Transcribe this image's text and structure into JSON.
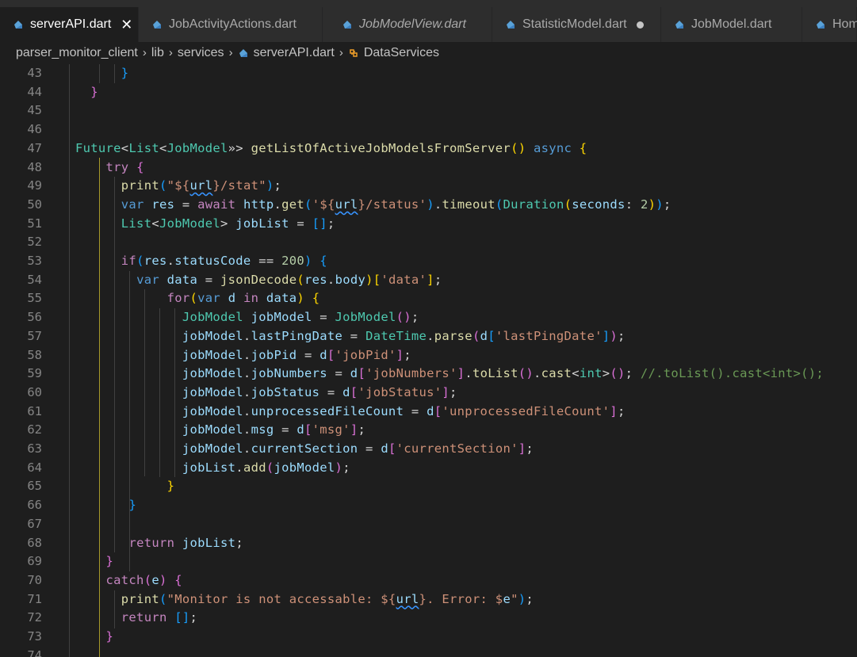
{
  "tabs": [
    {
      "label": "serverAPI.dart",
      "active": true,
      "italic": false,
      "close": "✕"
    },
    {
      "label": "JobActivityActions.dart",
      "active": false,
      "italic": false
    },
    {
      "label": "JobModelView.dart",
      "active": false,
      "italic": true
    },
    {
      "label": "StatisticModel.dart",
      "active": false,
      "italic": false,
      "modified": true
    },
    {
      "label": "JobModel.dart",
      "active": false,
      "italic": false
    },
    {
      "label": "Hom",
      "active": false,
      "italic": false
    }
  ],
  "breadcrumb": {
    "items": [
      "parser_monitor_client",
      "lib",
      "services",
      "serverAPI.dart",
      "DataServices"
    ],
    "separator": "›"
  },
  "colors": {
    "background": "#1e1e1e",
    "tab_inactive": "#2d2d2d",
    "keyword": "#569cd6",
    "control": "#c586c0",
    "type": "#4ec9b0",
    "function": "#dcdcaa",
    "string": "#ce9178",
    "number": "#b5cea8",
    "variable": "#9cdcfe",
    "comment": "#6a9955",
    "dart_icon": "#5aa2d8"
  },
  "lines": [
    {
      "n": "43",
      "indent": "      ",
      "tokens": [
        [
          "b3",
          "}"
        ]
      ]
    },
    {
      "n": "44",
      "indent": "  ",
      "tokens": [
        [
          "b2",
          "}"
        ]
      ]
    },
    {
      "n": "45",
      "indent": "",
      "tokens": []
    },
    {
      "n": "46",
      "indent": "",
      "tokens": []
    },
    {
      "n": "47",
      "indent": "",
      "tokens": [
        [
          "typ",
          "Future"
        ],
        [
          "pl",
          "<"
        ],
        [
          "typ",
          "List"
        ],
        [
          "pl",
          "<"
        ],
        [
          "typ",
          "JobModel"
        ],
        [
          "pl",
          "»> "
        ],
        [
          "fn",
          "getListOfActiveJobModelsFromServer"
        ],
        [
          "b1",
          "()"
        ],
        [
          "pl",
          " "
        ],
        [
          "kw",
          "async"
        ],
        [
          "pl",
          " "
        ],
        [
          "b1",
          "{"
        ]
      ]
    },
    {
      "n": "48",
      "indent": "    ",
      "tokens": [
        [
          "ctl",
          "try"
        ],
        [
          "pl",
          " "
        ],
        [
          "b2",
          "{"
        ]
      ]
    },
    {
      "n": "49",
      "indent": "      ",
      "tokens": [
        [
          "fn",
          "print"
        ],
        [
          "b3",
          "("
        ],
        [
          "str",
          "\"${"
        ],
        [
          "var squig",
          "url"
        ],
        [
          "str",
          "}/stat\""
        ],
        [
          "b3",
          ")"
        ],
        [
          "pl",
          ";"
        ]
      ]
    },
    {
      "n": "50",
      "indent": "      ",
      "tokens": [
        [
          "kw",
          "var"
        ],
        [
          "pl",
          " "
        ],
        [
          "var",
          "res"
        ],
        [
          "pl",
          " = "
        ],
        [
          "ctl",
          "await"
        ],
        [
          "pl",
          " "
        ],
        [
          "var",
          "http"
        ],
        [
          "pl",
          "."
        ],
        [
          "fn",
          "get"
        ],
        [
          "b3",
          "("
        ],
        [
          "str",
          "'${"
        ],
        [
          "var squig",
          "url"
        ],
        [
          "str",
          "}/status'"
        ],
        [
          "b3",
          ")"
        ],
        [
          "pl",
          "."
        ],
        [
          "fn",
          "timeout"
        ],
        [
          "b3",
          "("
        ],
        [
          "typ",
          "Duration"
        ],
        [
          "b1",
          "("
        ],
        [
          "var",
          "seconds"
        ],
        [
          "pl",
          ": "
        ],
        [
          "num",
          "2"
        ],
        [
          "b1",
          ")"
        ],
        [
          "b3",
          ")"
        ],
        [
          "pl",
          ";"
        ]
      ]
    },
    {
      "n": "51",
      "indent": "      ",
      "tokens": [
        [
          "typ",
          "List"
        ],
        [
          "pl",
          "<"
        ],
        [
          "typ",
          "JobModel"
        ],
        [
          "pl",
          "> "
        ],
        [
          "var",
          "jobList"
        ],
        [
          "pl",
          " = "
        ],
        [
          "b3",
          "[]"
        ],
        [
          "pl",
          ";"
        ]
      ]
    },
    {
      "n": "52",
      "indent": "",
      "tokens": []
    },
    {
      "n": "53",
      "indent": "      ",
      "tokens": [
        [
          "ctl",
          "if"
        ],
        [
          "b3",
          "("
        ],
        [
          "var",
          "res"
        ],
        [
          "pl",
          "."
        ],
        [
          "var",
          "statusCode"
        ],
        [
          "pl",
          " == "
        ],
        [
          "num",
          "200"
        ],
        [
          "b3",
          ")"
        ],
        [
          "pl",
          " "
        ],
        [
          "b3",
          "{"
        ]
      ]
    },
    {
      "n": "54",
      "indent": "        ",
      "tokens": [
        [
          "kw",
          "var"
        ],
        [
          "pl",
          " "
        ],
        [
          "var",
          "data"
        ],
        [
          "pl",
          " = "
        ],
        [
          "fn",
          "jsonDecode"
        ],
        [
          "b1",
          "("
        ],
        [
          "var",
          "res"
        ],
        [
          "pl",
          "."
        ],
        [
          "var",
          "body"
        ],
        [
          "b1",
          ")"
        ],
        [
          "b1",
          "["
        ],
        [
          "str",
          "'data'"
        ],
        [
          "b1",
          "]"
        ],
        [
          "pl",
          ";"
        ]
      ]
    },
    {
      "n": "55",
      "indent": "            ",
      "tokens": [
        [
          "ctl",
          "for"
        ],
        [
          "b1",
          "("
        ],
        [
          "kw",
          "var"
        ],
        [
          "pl",
          " "
        ],
        [
          "var",
          "d"
        ],
        [
          "pl",
          " "
        ],
        [
          "ctl",
          "in"
        ],
        [
          "pl",
          " "
        ],
        [
          "var",
          "data"
        ],
        [
          "b1",
          ")"
        ],
        [
          "pl",
          " "
        ],
        [
          "b1",
          "{"
        ]
      ]
    },
    {
      "n": "56",
      "indent": "              ",
      "tokens": [
        [
          "typ",
          "JobModel"
        ],
        [
          "pl",
          " "
        ],
        [
          "var",
          "jobModel"
        ],
        [
          "pl",
          " = "
        ],
        [
          "typ",
          "JobModel"
        ],
        [
          "b2",
          "()"
        ],
        [
          "pl",
          ";"
        ]
      ]
    },
    {
      "n": "57",
      "indent": "              ",
      "tokens": [
        [
          "var",
          "jobModel"
        ],
        [
          "pl",
          "."
        ],
        [
          "var",
          "lastPingDate"
        ],
        [
          "pl",
          " = "
        ],
        [
          "typ",
          "DateTime"
        ],
        [
          "pl",
          "."
        ],
        [
          "fn",
          "parse"
        ],
        [
          "b2",
          "("
        ],
        [
          "var",
          "d"
        ],
        [
          "b3",
          "["
        ],
        [
          "str",
          "'lastPingDate'"
        ],
        [
          "b3",
          "]"
        ],
        [
          "b2",
          ")"
        ],
        [
          "pl",
          ";"
        ]
      ]
    },
    {
      "n": "58",
      "indent": "              ",
      "tokens": [
        [
          "var",
          "jobModel"
        ],
        [
          "pl",
          "."
        ],
        [
          "var",
          "jobPid"
        ],
        [
          "pl",
          " = "
        ],
        [
          "var",
          "d"
        ],
        [
          "b2",
          "["
        ],
        [
          "str",
          "'jobPid'"
        ],
        [
          "b2",
          "]"
        ],
        [
          "pl",
          ";"
        ]
      ]
    },
    {
      "n": "59",
      "indent": "              ",
      "tokens": [
        [
          "var",
          "jobModel"
        ],
        [
          "pl",
          "."
        ],
        [
          "var",
          "jobNumbers"
        ],
        [
          "pl",
          " = "
        ],
        [
          "var",
          "d"
        ],
        [
          "b2",
          "["
        ],
        [
          "str",
          "'jobNumbers'"
        ],
        [
          "b2",
          "]"
        ],
        [
          "pl",
          "."
        ],
        [
          "fn",
          "toList"
        ],
        [
          "b2",
          "()"
        ],
        [
          "pl",
          "."
        ],
        [
          "fn",
          "cast"
        ],
        [
          "pl",
          "<"
        ],
        [
          "typ",
          "int"
        ],
        [
          "pl",
          ">"
        ],
        [
          "b2",
          "()"
        ],
        [
          "pl",
          "; "
        ],
        [
          "cmt",
          "//.toList().cast<int>();"
        ]
      ]
    },
    {
      "n": "60",
      "indent": "              ",
      "tokens": [
        [
          "var",
          "jobModel"
        ],
        [
          "pl",
          "."
        ],
        [
          "var",
          "jobStatus"
        ],
        [
          "pl",
          " = "
        ],
        [
          "var",
          "d"
        ],
        [
          "b2",
          "["
        ],
        [
          "str",
          "'jobStatus'"
        ],
        [
          "b2",
          "]"
        ],
        [
          "pl",
          ";"
        ]
      ]
    },
    {
      "n": "61",
      "indent": "              ",
      "tokens": [
        [
          "var",
          "jobModel"
        ],
        [
          "pl",
          "."
        ],
        [
          "var",
          "unprocessedFileCount"
        ],
        [
          "pl",
          " = "
        ],
        [
          "var",
          "d"
        ],
        [
          "b2",
          "["
        ],
        [
          "str",
          "'unprocessedFileCount'"
        ],
        [
          "b2",
          "]"
        ],
        [
          "pl",
          ";"
        ]
      ]
    },
    {
      "n": "62",
      "indent": "              ",
      "tokens": [
        [
          "var",
          "jobModel"
        ],
        [
          "pl",
          "."
        ],
        [
          "var",
          "msg"
        ],
        [
          "pl",
          " = "
        ],
        [
          "var",
          "d"
        ],
        [
          "b2",
          "["
        ],
        [
          "str",
          "'msg'"
        ],
        [
          "b2",
          "]"
        ],
        [
          "pl",
          ";"
        ]
      ]
    },
    {
      "n": "63",
      "indent": "              ",
      "tokens": [
        [
          "var",
          "jobModel"
        ],
        [
          "pl",
          "."
        ],
        [
          "var",
          "currentSection"
        ],
        [
          "pl",
          " = "
        ],
        [
          "var",
          "d"
        ],
        [
          "b2",
          "["
        ],
        [
          "str",
          "'currentSection'"
        ],
        [
          "b2",
          "]"
        ],
        [
          "pl",
          ";"
        ]
      ]
    },
    {
      "n": "64",
      "indent": "              ",
      "tokens": [
        [
          "var",
          "jobList"
        ],
        [
          "pl",
          "."
        ],
        [
          "fn",
          "add"
        ],
        [
          "b2",
          "("
        ],
        [
          "var",
          "jobModel"
        ],
        [
          "b2",
          ")"
        ],
        [
          "pl",
          ";"
        ]
      ]
    },
    {
      "n": "65",
      "indent": "            ",
      "tokens": [
        [
          "b1",
          "}"
        ]
      ]
    },
    {
      "n": "66",
      "indent": "       ",
      "tokens": [
        [
          "b3",
          "}"
        ]
      ]
    },
    {
      "n": "67",
      "indent": "",
      "tokens": []
    },
    {
      "n": "68",
      "indent": "       ",
      "tokens": [
        [
          "ctl",
          "return"
        ],
        [
          "pl",
          " "
        ],
        [
          "var",
          "jobList"
        ],
        [
          "pl",
          ";"
        ]
      ]
    },
    {
      "n": "69",
      "indent": "    ",
      "tokens": [
        [
          "b2",
          "}"
        ]
      ]
    },
    {
      "n": "70",
      "indent": "    ",
      "tokens": [
        [
          "ctl",
          "catch"
        ],
        [
          "b2",
          "("
        ],
        [
          "var",
          "e"
        ],
        [
          "b2",
          ")"
        ],
        [
          "pl",
          " "
        ],
        [
          "b2",
          "{"
        ]
      ]
    },
    {
      "n": "71",
      "indent": "      ",
      "tokens": [
        [
          "fn",
          "print"
        ],
        [
          "b3",
          "("
        ],
        [
          "str",
          "\"Monitor is not accessable: ${"
        ],
        [
          "var squig",
          "url"
        ],
        [
          "str",
          "}. Error: $"
        ],
        [
          "var",
          "e"
        ],
        [
          "str",
          "\""
        ],
        [
          "b3",
          ")"
        ],
        [
          "pl",
          ";"
        ]
      ]
    },
    {
      "n": "72",
      "indent": "      ",
      "tokens": [
        [
          "ctl",
          "return"
        ],
        [
          "pl",
          " "
        ],
        [
          "b3",
          "[]"
        ],
        [
          "pl",
          ";"
        ]
      ]
    },
    {
      "n": "73",
      "indent": "    ",
      "tokens": [
        [
          "b2",
          "}"
        ]
      ]
    },
    {
      "n": "74",
      "indent": "",
      "tokens": []
    }
  ]
}
